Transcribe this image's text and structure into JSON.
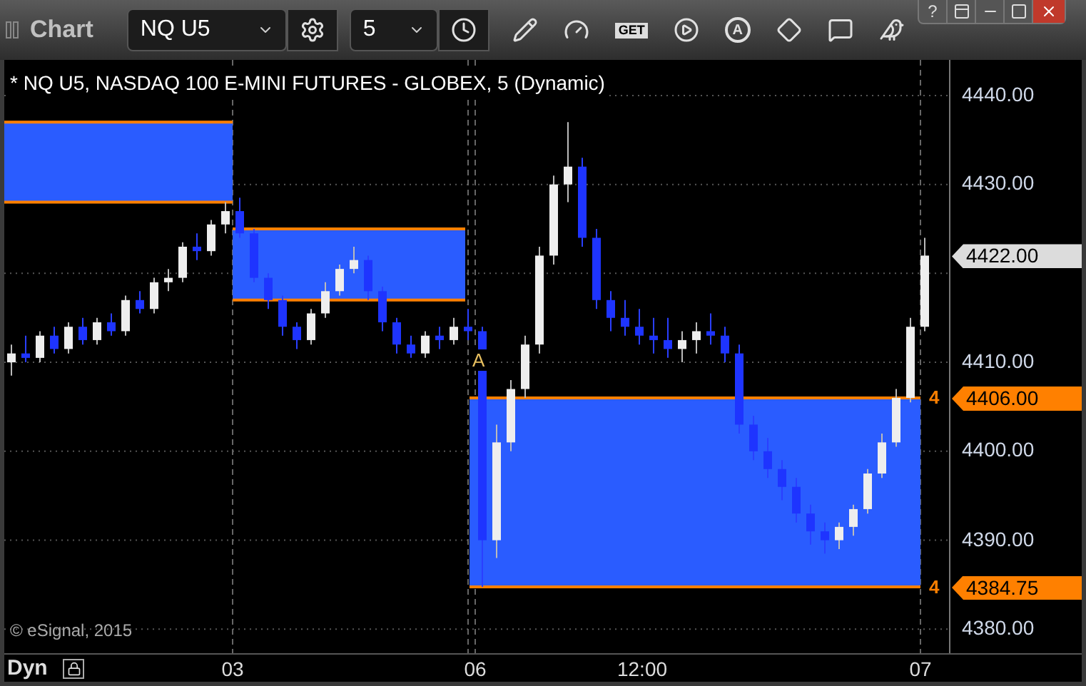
{
  "window": {
    "title": "Chart",
    "help": "?"
  },
  "toolbar": {
    "symbol": "NQ U5",
    "interval": "5",
    "get_label": "GET",
    "alert_label": "A"
  },
  "chart": {
    "legend": "* NQ U5, NASDAQ 100 E-MINI FUTURES - GLOBEX, 5 (Dynamic)",
    "marker": "A",
    "copyright": "© eSignal, 2015",
    "chart_data": {
      "type": "candlestick",
      "categories": [
        null,
        null,
        null,
        null,
        null,
        null,
        null,
        null,
        null,
        null,
        null,
        null,
        null,
        null,
        null,
        null,
        null,
        null,
        null,
        null,
        null,
        null,
        null,
        null,
        null,
        null,
        null,
        null,
        null,
        null,
        null,
        null,
        null,
        null,
        null,
        null,
        null,
        null,
        null,
        null,
        null,
        null,
        null,
        null,
        null,
        null,
        null,
        null,
        null,
        null,
        null,
        null,
        null,
        null,
        null,
        null,
        null,
        null,
        null,
        null,
        null,
        null,
        null,
        null,
        null
      ],
      "ohlc": [
        [
          4410,
          4412,
          4408.5,
          4411
        ],
        [
          4411,
          4413,
          4410,
          4410.5
        ],
        [
          4410.5,
          4413.5,
          4410,
          4413
        ],
        [
          4413,
          4414,
          4411,
          4411.5
        ],
        [
          4411.5,
          4414.5,
          4411,
          4414
        ],
        [
          4414,
          4415,
          4412,
          4412.5
        ],
        [
          4412.5,
          4415,
          4412,
          4414.5
        ],
        [
          4414.5,
          4415.5,
          4413,
          4413.5
        ],
        [
          4413.5,
          4417.5,
          4413,
          4417
        ],
        [
          4417,
          4418,
          4415.5,
          4416
        ],
        [
          4416,
          4419.5,
          4415.5,
          4419
        ],
        [
          4419,
          4420.5,
          4418,
          4419.5
        ],
        [
          4419.5,
          4423.5,
          4419,
          4423
        ],
        [
          4423,
          4424.5,
          4421.5,
          4422.5
        ],
        [
          4422.5,
          4426,
          4422,
          4425.5
        ],
        [
          4425.5,
          4428,
          4424.5,
          4427
        ],
        [
          4427,
          4428.5,
          4424,
          4424.5
        ],
        [
          4424.5,
          4425,
          4419,
          4419.5
        ],
        [
          4419.5,
          4420,
          4416,
          4417
        ],
        [
          4417,
          4417.5,
          4413,
          4414
        ],
        [
          4414,
          4414.5,
          4411.5,
          4412.5
        ],
        [
          4412.5,
          4416,
          4412,
          4415.5
        ],
        [
          4415.5,
          4419,
          4415,
          4418
        ],
        [
          4418,
          4421,
          4417.5,
          4420.5
        ],
        [
          4420.5,
          4423,
          4420,
          4421.5
        ],
        [
          4421.5,
          4422,
          4417,
          4418
        ],
        [
          4418,
          4418.5,
          4413.5,
          4414.5
        ],
        [
          4414.5,
          4415,
          4411,
          4412
        ],
        [
          4412,
          4413,
          4410.5,
          4411
        ],
        [
          4411,
          4413.5,
          4410.5,
          4413
        ],
        [
          4413,
          4414,
          4411.5,
          4412.5
        ],
        [
          4412.5,
          4415,
          4412,
          4414
        ],
        [
          4414,
          4416,
          4412.5,
          4413.5
        ],
        [
          4413.5,
          4414,
          4384.75,
          4390
        ],
        [
          4390,
          4403,
          4388,
          4401
        ],
        [
          4401,
          4408,
          4400,
          4407
        ],
        [
          4407,
          4413,
          4406,
          4412
        ],
        [
          4412,
          4423,
          4411,
          4422
        ],
        [
          4422,
          4431,
          4421,
          4430
        ],
        [
          4430,
          4437,
          4428,
          4432
        ],
        [
          4432,
          4433,
          4423,
          4424
        ],
        [
          4424,
          4425,
          4416,
          4417
        ],
        [
          4417,
          4418,
          4413.5,
          4415
        ],
        [
          4415,
          4417,
          4413,
          4414
        ],
        [
          4414,
          4416,
          4412,
          4413
        ],
        [
          4413,
          4415,
          4411,
          4412.5
        ],
        [
          4412.5,
          4415,
          4410.5,
          4411.5
        ],
        [
          4411.5,
          4413.5,
          4410,
          4412.5
        ],
        [
          4412.5,
          4414.5,
          4411,
          4413.5
        ],
        [
          4413.5,
          4415.5,
          4412,
          4413
        ],
        [
          4413,
          4414,
          4410,
          4411
        ],
        [
          4411,
          4412,
          4402,
          4403
        ],
        [
          4403,
          4404,
          4399,
          4400
        ],
        [
          4400,
          4401.5,
          4397,
          4398
        ],
        [
          4398,
          4399,
          4394.5,
          4396
        ],
        [
          4396,
          4397,
          4392,
          4393
        ],
        [
          4393,
          4394,
          4389.5,
          4391
        ],
        [
          4391,
          4392,
          4388.5,
          4390
        ],
        [
          4390,
          4392,
          4389,
          4391.5
        ],
        [
          4391.5,
          4394,
          4390.5,
          4393.5
        ],
        [
          4393.5,
          4398,
          4393,
          4397.5
        ],
        [
          4397.5,
          4402,
          4397,
          4401
        ],
        [
          4401,
          4407,
          4400.5,
          4406
        ],
        [
          4406,
          4415,
          4405.5,
          4414
        ],
        [
          4414,
          4424,
          4413.5,
          4422
        ]
      ],
      "grid": true,
      "ylim": [
        4377.3,
        4444.0
      ],
      "yticks": [
        {
          "value": 4440,
          "label": "4440.00"
        },
        {
          "value": 4430,
          "label": "4430.00"
        },
        {
          "value": 4410,
          "label": "4410.00"
        },
        {
          "value": 4400,
          "label": "4400.00"
        },
        {
          "value": 4390,
          "label": "4390.00"
        },
        {
          "value": 4380,
          "label": "4380.00"
        }
      ]
    },
    "tags": [
      {
        "kind": "last",
        "text": "4422.00"
      },
      {
        "kind": "level",
        "text": "4406.00",
        "edge": "4"
      },
      {
        "kind": "level",
        "text": "4384.75",
        "edge": "4"
      }
    ],
    "time_labels": [
      "03",
      "06",
      "12:00",
      "07"
    ],
    "mode": "Dyn"
  }
}
